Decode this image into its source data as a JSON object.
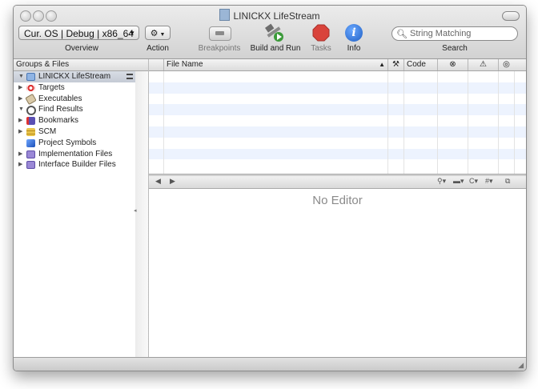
{
  "window": {
    "title": "LINICKX LifeStream"
  },
  "toolbar": {
    "overview_value": "Cur. OS | Debug | x86_64",
    "overview_label": "Overview",
    "action_label": "Action",
    "breakpoints_label": "Breakpoints",
    "build_run_label": "Build and Run",
    "tasks_label": "Tasks",
    "info_label": "Info",
    "search_label": "Search",
    "search_placeholder": "String Matching"
  },
  "sidebar": {
    "header": "Groups & Files",
    "items": [
      {
        "label": "LINICKX LifeStream",
        "icon": "project-icon",
        "expanded": true
      },
      {
        "label": "Targets",
        "icon": "target-icon"
      },
      {
        "label": "Executables",
        "icon": "executable-icon"
      },
      {
        "label": "Find Results",
        "icon": "magnifier-icon",
        "expanded": true
      },
      {
        "label": "Bookmarks",
        "icon": "bookmark-icon"
      },
      {
        "label": "SCM",
        "icon": "scm-icon"
      },
      {
        "label": "Project Symbols",
        "icon": "cube-icon"
      },
      {
        "label": "Implementation Files",
        "icon": "smart-group-icon"
      },
      {
        "label": "Interface Builder Files",
        "icon": "smart-group-icon"
      }
    ]
  },
  "filelist": {
    "columns": {
      "file_name": "File Name",
      "code": "Code"
    }
  },
  "editor": {
    "empty_message": "No Editor"
  },
  "colors": {
    "row_alt": "#edf3fe",
    "selection": "#c9ced8",
    "tasks_red": "#d9433b",
    "info_blue": "#2a6fd6"
  }
}
